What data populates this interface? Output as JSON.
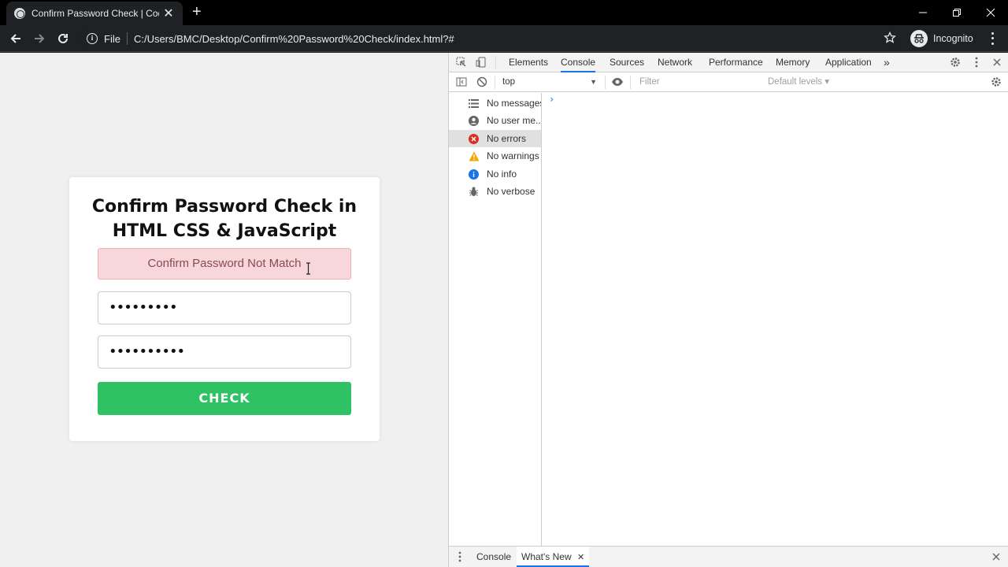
{
  "browser": {
    "tab_title": "Confirm Password Check | Codin",
    "tab_close": "✕",
    "new_tab": "+",
    "scheme": "File",
    "url": "C:/Users/BMC/Desktop/Confirm%20Password%20Check/index.html?#",
    "profile_label": "Incognito",
    "window_controls": [
      "minimize",
      "restore",
      "close"
    ]
  },
  "page": {
    "heading": "Confirm Password Check in HTML CSS & JavaScript",
    "alert_text": "Confirm Password Not Match",
    "password_dots": "•••••••••",
    "confirm_dots": "••••••••••",
    "check_label": "CHECK",
    "colors": {
      "background": "#f0f0f0",
      "alert_bg": "#f8d7da",
      "alert_text": "#8a4a50",
      "button": "#2ec264"
    }
  },
  "devtools": {
    "tabs": [
      {
        "label": "Elements"
      },
      {
        "label": "Console"
      },
      {
        "label": "Sources"
      },
      {
        "label": "Network"
      },
      {
        "label": "Performance"
      },
      {
        "label": "Memory"
      },
      {
        "label": "Application"
      }
    ],
    "more_tabs": "»",
    "active_tab": "Console",
    "context": "top",
    "filter_placeholder": "Filter",
    "levels": "Default levels ▾",
    "sidebar": [
      {
        "label": "No messages",
        "icon": "list-icon"
      },
      {
        "label": "No user me...",
        "icon": "user-icon"
      },
      {
        "label": "No errors",
        "icon": "error-icon"
      },
      {
        "label": "No warnings",
        "icon": "warning-icon"
      },
      {
        "label": "No info",
        "icon": "info-icon"
      },
      {
        "label": "No verbose",
        "icon": "bug-icon"
      }
    ],
    "selected_sidebar": "No errors",
    "prompt": "›",
    "drawer_tabs": [
      "Console",
      "What's New"
    ],
    "drawer_active": "What's New",
    "accent": "#1a73e8"
  }
}
